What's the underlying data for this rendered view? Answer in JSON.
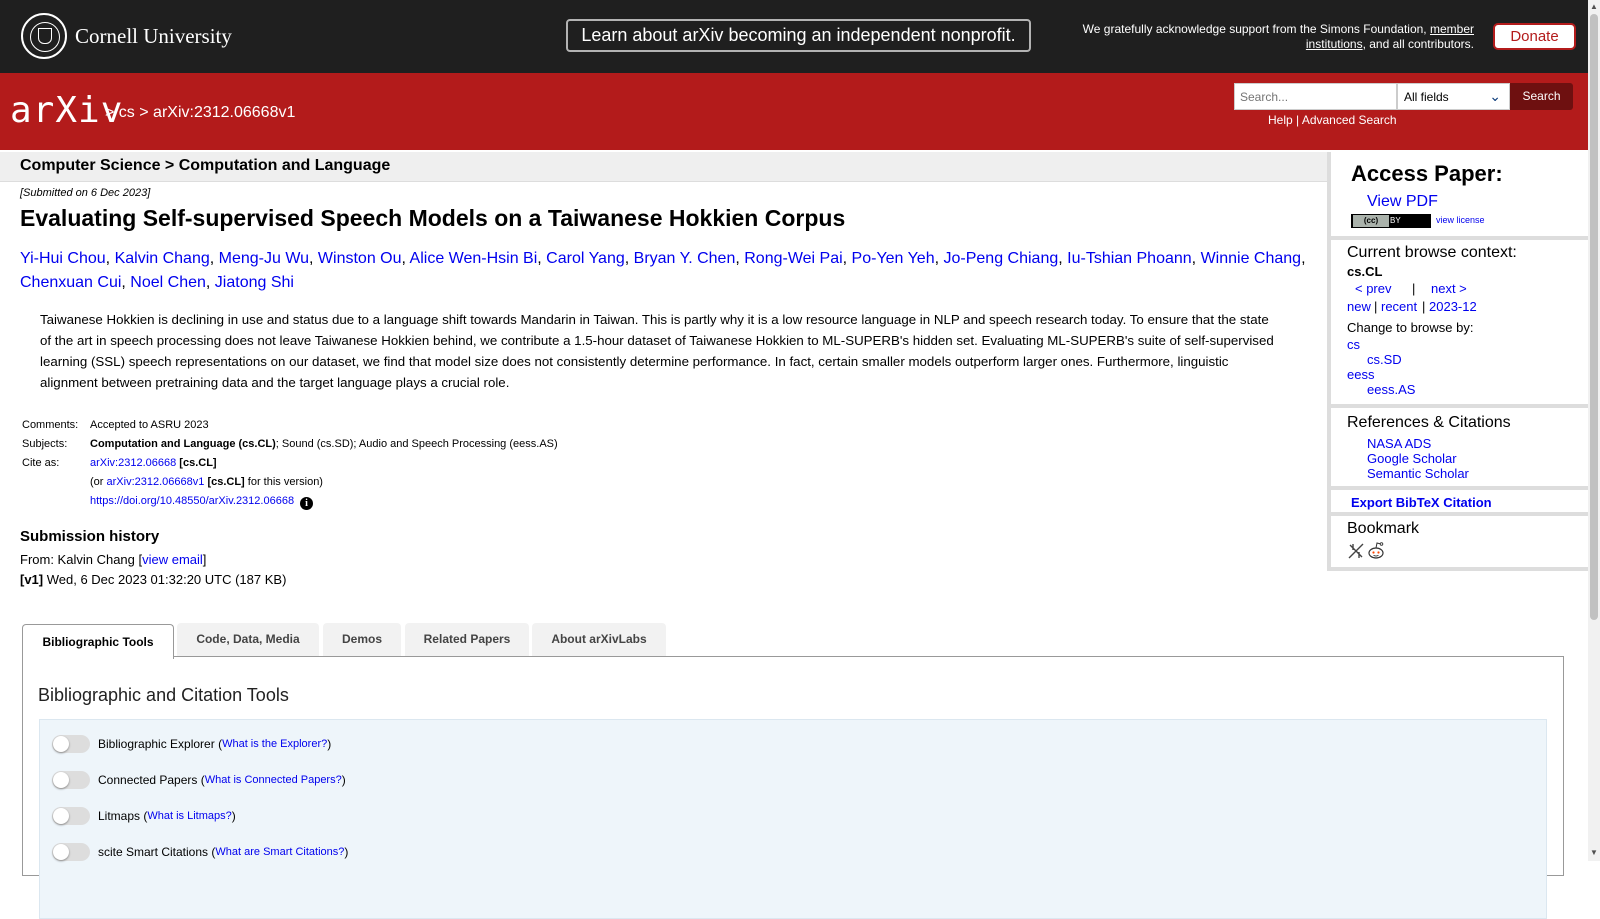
{
  "topbar": {
    "university": "Cornell University",
    "announcement": "Learn about arXiv becoming an independent nonprofit.",
    "support_text": "We gratefully acknowledge support from the Simons Foundation,",
    "support_link": "member institutions",
    "support_tail": ", and all contributors.",
    "donate": "Donate"
  },
  "header": {
    "logo": "arXiv",
    "crumb_sep": ">",
    "crumb_cs": "cs",
    "crumb_id": "arXiv:2312.06668v1",
    "search_placeholder": "Search...",
    "search_field": "All fields",
    "search_button": "Search",
    "help": "Help",
    "pipe": "|",
    "advanced": "Advanced Search"
  },
  "paper": {
    "subject_heading": "Computer Science > Computation and Language",
    "submitted": "[Submitted on 6 Dec 2023]",
    "title": "Evaluating Self-supervised Speech Models on a Taiwanese Hokkien Corpus",
    "authors": [
      "Yi-Hui Chou",
      "Kalvin Chang",
      "Meng-Ju Wu",
      "Winston Ou",
      "Alice Wen-Hsin Bi",
      "Carol Yang",
      "Bryan Y. Chen",
      "Rong-Wei Pai",
      "Po-Yen Yeh",
      "Jo-Peng Chiang",
      "Iu-Tshian Phoann",
      "Winnie Chang",
      "Chenxuan Cui",
      "Noel Chen",
      "Jiatong Shi"
    ],
    "abstract": "Taiwanese Hokkien is declining in use and status due to a language shift towards Mandarin in Taiwan. This is partly why it is a low resource language in NLP and speech research today. To ensure that the state of the art in speech processing does not leave Taiwanese Hokkien behind, we contribute a 1.5-hour dataset of Taiwanese Hokkien to ML-SUPERB's hidden set. Evaluating ML-SUPERB's suite of self-supervised learning (SSL) speech representations on our dataset, we find that model size does not consistently determine performance. In fact, certain smaller models outperform larger ones. Furthermore, linguistic alignment between pretraining data and the target language plays a crucial role.",
    "comments_label": "Comments:",
    "comments": "Accepted to ASRU 2023",
    "subjects_label": "Subjects:",
    "subjects_primary": "Computation and Language (cs.CL)",
    "subjects_rest": "; Sound (cs.SD); Audio and Speech Processing (eess.AS)",
    "cite_label": "Cite as:",
    "cite_id": "arXiv:2312.06668",
    "cite_cat": "[cs.CL]",
    "cite_or": "(or",
    "cite_version": "arXiv:2312.06668v1",
    "cite_version_cat": "[cs.CL]",
    "cite_version_tail": "for this version)",
    "doi": "https://doi.org/10.48550/arXiv.2312.06668",
    "info_icon": "i"
  },
  "history": {
    "heading": "Submission history",
    "from_prefix": "From: Kalvin Chang [",
    "view_email": "view email",
    "from_suffix": "]",
    "v1_label": "[v1]",
    "v1_text": " Wed, 6 Dec 2023 01:32:20 UTC (187 KB)"
  },
  "sidebar": {
    "access_heading": "Access Paper:",
    "view_pdf": "View PDF",
    "cc_left": "(cc)",
    "cc_right": "BY",
    "view_license": "view license",
    "browse_heading": "Current browse context:",
    "context": "cs.CL",
    "prev": "< prev",
    "pipe": "|",
    "next": "next >",
    "new": "new",
    "recent": "recent",
    "month": "2023-12",
    "change_label": "Change to browse by:",
    "cs": "cs",
    "cs_sd": "cs.SD",
    "eess": "eess",
    "eess_as": "eess.AS",
    "refs_heading": "References & Citations",
    "nasa": "NASA ADS",
    "google": "Google Scholar",
    "semantic": "Semantic Scholar",
    "export": "Export BibTeX Citation",
    "bookmark_heading": "Bookmark",
    "bookmark_icons": [
      "bibsonomy-icon",
      "reddit-icon"
    ]
  },
  "tabs": [
    "Bibliographic Tools",
    "Code, Data, Media",
    "Demos",
    "Related Papers",
    "About arXivLabs"
  ],
  "tools": {
    "heading": "Bibliographic and Citation Tools",
    "items": [
      {
        "name": "Bibliographic Explorer",
        "what": "What is the Explorer?"
      },
      {
        "name": "Connected Papers",
        "what": "What is Connected Papers?"
      },
      {
        "name": "Litmaps",
        "what": "What is Litmaps?"
      },
      {
        "name": "scite Smart Citations",
        "what": "What are Smart Citations?"
      }
    ]
  },
  "colors": {
    "arxiv_red": "#b31b1b",
    "topbar": "#1f1f1f",
    "link": "#0000ee"
  }
}
